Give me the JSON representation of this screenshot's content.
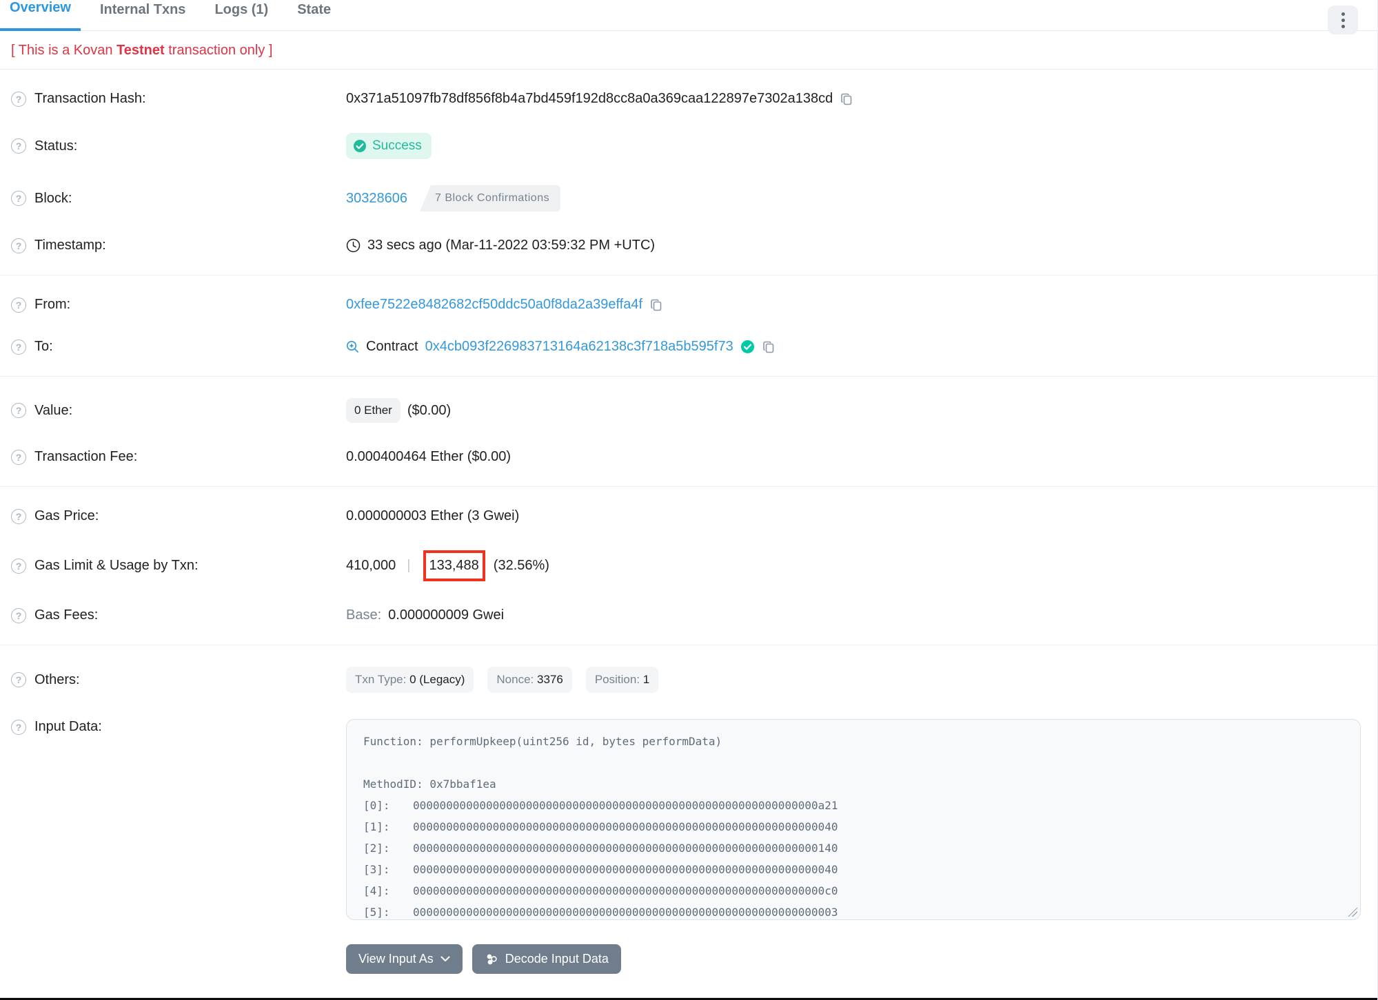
{
  "tabs": [
    {
      "label": "Overview",
      "active": true
    },
    {
      "label": "Internal Txns",
      "active": false
    },
    {
      "label": "Logs (1)",
      "active": false
    },
    {
      "label": "State",
      "active": false
    }
  ],
  "warning": {
    "prefix": "[ This is a Kovan ",
    "bold": "Testnet",
    "suffix": " transaction only ]"
  },
  "rows": {
    "transaction_hash": {
      "label": "Transaction Hash:",
      "value": "0x371a51097fb78df856f8b4a7bd459f192d8cc8a0a369caa122897e7302a138cd"
    },
    "status": {
      "label": "Status:",
      "value": "Success"
    },
    "block": {
      "label": "Block:",
      "number": "30328606",
      "confirmations": "7 Block Confirmations"
    },
    "timestamp": {
      "label": "Timestamp:",
      "value": "33 secs ago (Mar-11-2022 03:59:32 PM +UTC)"
    },
    "from": {
      "label": "From:",
      "address": "0xfee7522e8482682cf50ddc50a0f8da2a39effa4f"
    },
    "to": {
      "label": "To:",
      "prefix": "Contract",
      "address": "0x4cb093f226983713164a62138c3f718a5b595f73"
    },
    "value": {
      "label": "Value:",
      "badge": "0 Ether",
      "usd": "($0.00)"
    },
    "transaction_fee": {
      "label": "Transaction Fee:",
      "value": "0.000400464 Ether ($0.00)"
    },
    "gas_price": {
      "label": "Gas Price:",
      "value": "0.000000003 Ether (3 Gwei)"
    },
    "gas_limit": {
      "label": "Gas Limit & Usage by Txn:",
      "limit": "410,000",
      "pipe": "|",
      "used": "133,488",
      "percent": "(32.56%)"
    },
    "gas_fees": {
      "label": "Gas Fees:",
      "base_label": "Base:",
      "base_value": "0.000000009 Gwei"
    },
    "others": {
      "label": "Others:",
      "badges": [
        {
          "k": "Txn Type:",
          "v": "0 (Legacy)"
        },
        {
          "k": "Nonce:",
          "v": "3376"
        },
        {
          "k": "Position:",
          "v": "1"
        }
      ]
    },
    "input_data": {
      "label": "Input Data:",
      "function_line": "Function: performUpkeep(uint256 id, bytes performData)",
      "method_line": "MethodID: 0x7bbaf1ea",
      "words": [
        {
          "idx": "[0]:",
          "hex": "0000000000000000000000000000000000000000000000000000000000000a21"
        },
        {
          "idx": "[1]:",
          "hex": "0000000000000000000000000000000000000000000000000000000000000040"
        },
        {
          "idx": "[2]:",
          "hex": "0000000000000000000000000000000000000000000000000000000000000140"
        },
        {
          "idx": "[3]:",
          "hex": "0000000000000000000000000000000000000000000000000000000000000040"
        },
        {
          "idx": "[4]:",
          "hex": "00000000000000000000000000000000000000000000000000000000000000c0"
        },
        {
          "idx": "[5]:",
          "hex": "0000000000000000000000000000000000000000000000000000000000000003"
        }
      ]
    }
  },
  "buttons": {
    "view_input_as": "View Input As",
    "decode_input_data": "Decode Input Data"
  },
  "colors": {
    "accent_blue": "#2c97de",
    "link_blue": "#3498db",
    "success_teal": "#20ba9c",
    "success_bg": "#dff7ef",
    "warning_red": "#dc3545",
    "annotation_red": "#f0331f",
    "button_slate": "#6f7d8c"
  }
}
